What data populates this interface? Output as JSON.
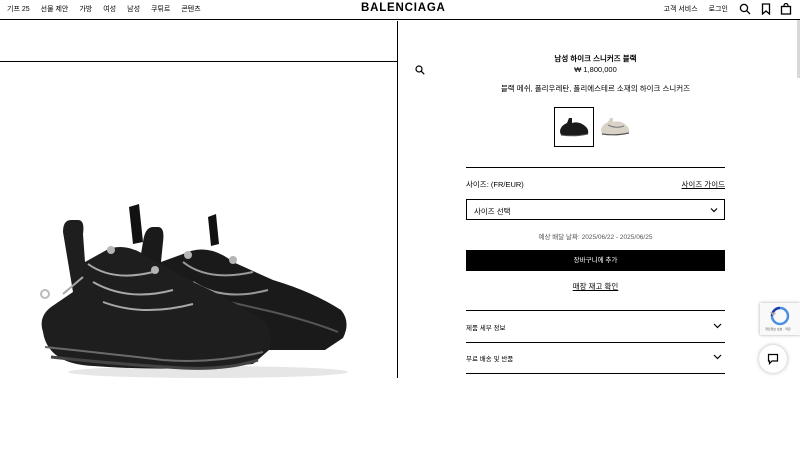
{
  "header": {
    "brand": "BALENCIAGA",
    "nav_left": [
      "기프 25",
      "선물 제안",
      "가방",
      "여성",
      "남성",
      "쿠튀르",
      "콘텐츠"
    ],
    "nav_right": [
      "고객 서비스",
      "로그인"
    ],
    "icons": [
      "search-icon",
      "bookmark-icon",
      "shopping-bag-icon"
    ]
  },
  "product": {
    "name": "남성 하이크 스니커즈 블랙",
    "price": "₩ 1,800,000",
    "description": "블랙 메쉬, 폴리우레탄, 폴리에스테르 소재의 하이크 스니커즈",
    "swatches": [
      {
        "color": "black",
        "selected": true
      },
      {
        "color": "beige",
        "selected": false
      }
    ],
    "size_label": "사이즈: (FR/EUR)",
    "size_guide": "사이즈 가이드",
    "size_select_placeholder": "사이즈 선택",
    "delivery_estimate": "예상 배달 날짜: 2025/06/22 - 2025/06/25",
    "add_to_cart": "장바구니에 추가",
    "store_stock": "매장 재고 확인",
    "accordions": [
      "제품 세부 정보",
      "무료 배송 및 반품"
    ]
  },
  "widgets": {
    "recaptcha_text": "개인정보 보호 · 약관"
  },
  "colors": {
    "primary": "#000000",
    "background": "#ffffff",
    "muted_text": "#555555"
  }
}
